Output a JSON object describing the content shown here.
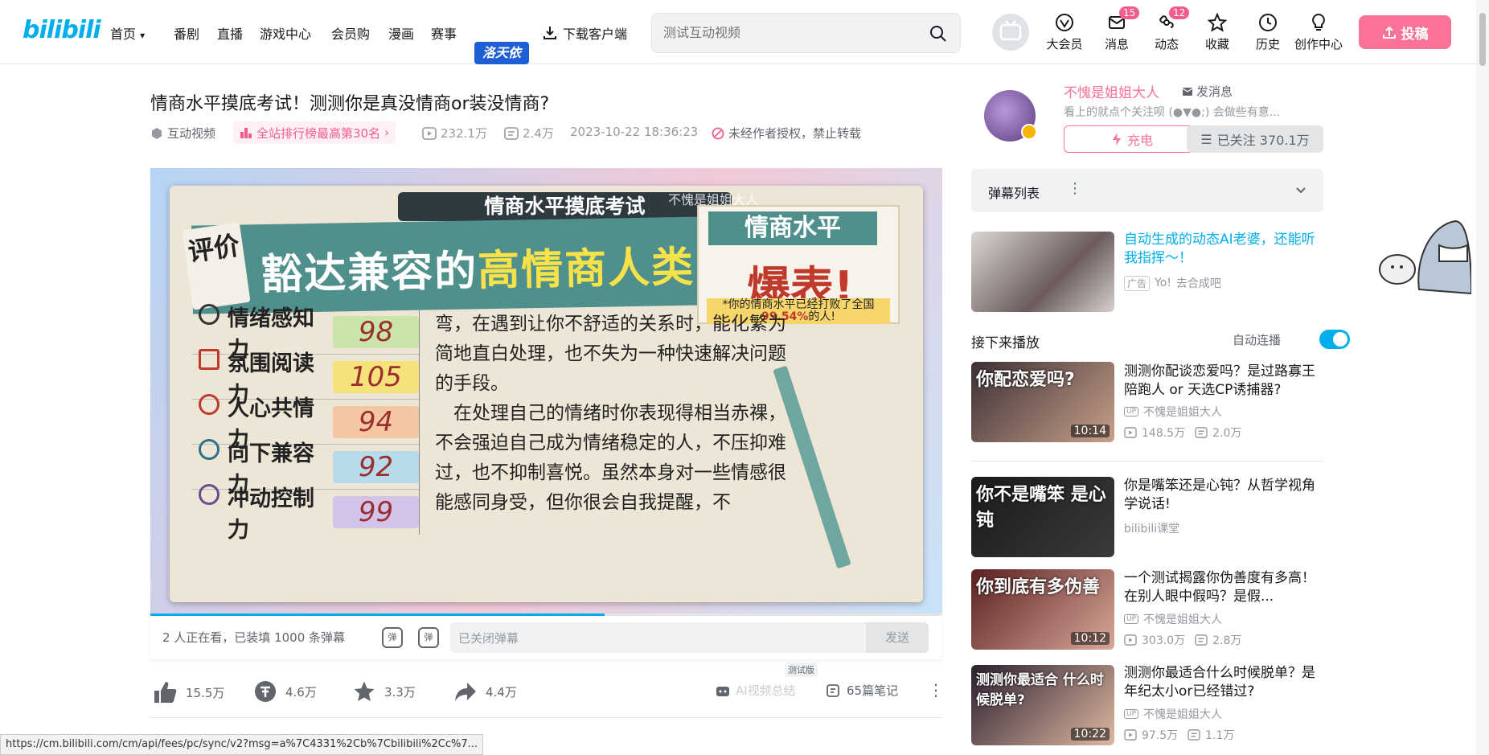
{
  "header": {
    "logo": "bilibili",
    "nav": [
      {
        "label": "首页"
      },
      {
        "label": "番剧"
      },
      {
        "label": "直播"
      },
      {
        "label": "游戏中心"
      },
      {
        "label": "会员购"
      },
      {
        "label": "漫画"
      },
      {
        "label": "赛事"
      }
    ],
    "event_tag": "洛天依",
    "download_label": "下载客户端",
    "search_placeholder": "测试互动视频",
    "icons": [
      {
        "label": "大会员",
        "badge": ""
      },
      {
        "label": "消息",
        "badge": "15"
      },
      {
        "label": "动态",
        "badge": "12"
      },
      {
        "label": "收藏",
        "badge": ""
      },
      {
        "label": "历史",
        "badge": ""
      },
      {
        "label": "创作中心",
        "badge": ""
      }
    ],
    "upload_label": "投稿"
  },
  "video": {
    "title": "情商水平摸底考试！测测你是真没情商or装没情商?",
    "type": "互动视频",
    "rank": "全站排行榜最高第30名",
    "plays": "232.1万",
    "danmaku_count": "2.4万",
    "date": "2023-10-22 18:36:23",
    "copyright": "未经作者授权，禁止转载"
  },
  "player_frame": {
    "top_banner": "情商水平摸底考试",
    "watermark": "不愧是姐姐大人",
    "pingjia": "评价",
    "headline_prefix": "豁达兼容的",
    "headline_highlight": "高情商人类",
    "score_header": "情商水平",
    "score_word": "爆表!",
    "score_note_prefix": "*你的情商水平已经打败了全国",
    "score_percent": "99.54%",
    "score_note_suffix": "的人!",
    "stats": [
      {
        "label": "情绪感知力",
        "value": "98"
      },
      {
        "label": "氛围阅读力",
        "value": "105"
      },
      {
        "label": "人心共情力",
        "value": "94"
      },
      {
        "label": "向下兼容力",
        "value": "92"
      },
      {
        "label": "冲动控制力",
        "value": "99"
      }
    ],
    "paragraph1": "弯，在遇到让你不舒适的关系时，能化繁为简地直白处理，也不失为一种快速解决问题的手段。",
    "paragraph2": "在处理自己的情绪时你表现得相当赤裸，不会强迫自己成为情绪稳定的人，不压抑难过，也不抑制喜悦。虽然本身对一些情感很能感同身受，但你很会自我提醒，不"
  },
  "danmaku": {
    "watching": "2 人正在看，已装填 1000 条弹幕",
    "input_placeholder": "已关闭弹幕",
    "send_label": "发送",
    "icon1": "弹",
    "icon2": "弹"
  },
  "actions": {
    "like": "15.5万",
    "coin": "4.6万",
    "favorite": "3.3万",
    "share": "4.4万",
    "ai_summary": "AI视频总结",
    "beta": "测试版",
    "notes": "65篇笔记"
  },
  "status_url": "https://cm.bilibili.com/cm/api/fees/pc/sync/v2?msg=a%7C4331%2Cb%7Cbilibili%2Cc%7...",
  "uploader": {
    "name": "不愧是姐姐大人",
    "message_label": "发消息",
    "description": "看上的就点个关注呗 (●▼●;) 会做些有意...",
    "charge_label": "充电",
    "follow_label": "已关注 370.1万"
  },
  "danmaku_list": {
    "title": "弹幕列表"
  },
  "ad": {
    "title": "自动生成的动态AI老婆，还能听我指挥～！",
    "tag": "广告",
    "source": "Yo!",
    "cta": "去合成吧"
  },
  "next": {
    "heading": "接下来播放",
    "autoplay_label": "自动连播"
  },
  "recommendations": [
    {
      "title": "测测你配谈恋爱吗？是过路寡王陪跑人 or 天选CP诱捕器?",
      "up": "不愧是姐姐大人",
      "plays": "148.5万",
      "danmaku": "2.0万",
      "duration": "10:14",
      "caption": "你配恋爱吗?",
      "show_stats": true
    },
    {
      "title": "你是嘴笨还是心钝？从哲学视角学说话!",
      "up": "bilibili课堂",
      "plays": "",
      "danmaku": "",
      "duration": "",
      "caption": "你不是嘴笨 是心钝",
      "show_stats": false
    },
    {
      "title": "一个测试揭露你伪善度有多高！在别人眼中假吗？是假...",
      "up": "不愧是姐姐大人",
      "plays": "303.0万",
      "danmaku": "2.8万",
      "duration": "10:12",
      "caption": "你到底有多伪善",
      "show_stats": true
    },
    {
      "title": "测测你最适合什么时候脱单？是年纪太小or已经错过?",
      "up": "不愧是姐姐大人",
      "plays": "97.5万",
      "danmaku": "1.1万",
      "duration": "10:22",
      "caption": "测测你最适合 什么时候脱单?",
      "show_stats": true
    }
  ],
  "colors": {
    "brand_blue": "#00aeec",
    "brand_pink": "#fb7299"
  }
}
